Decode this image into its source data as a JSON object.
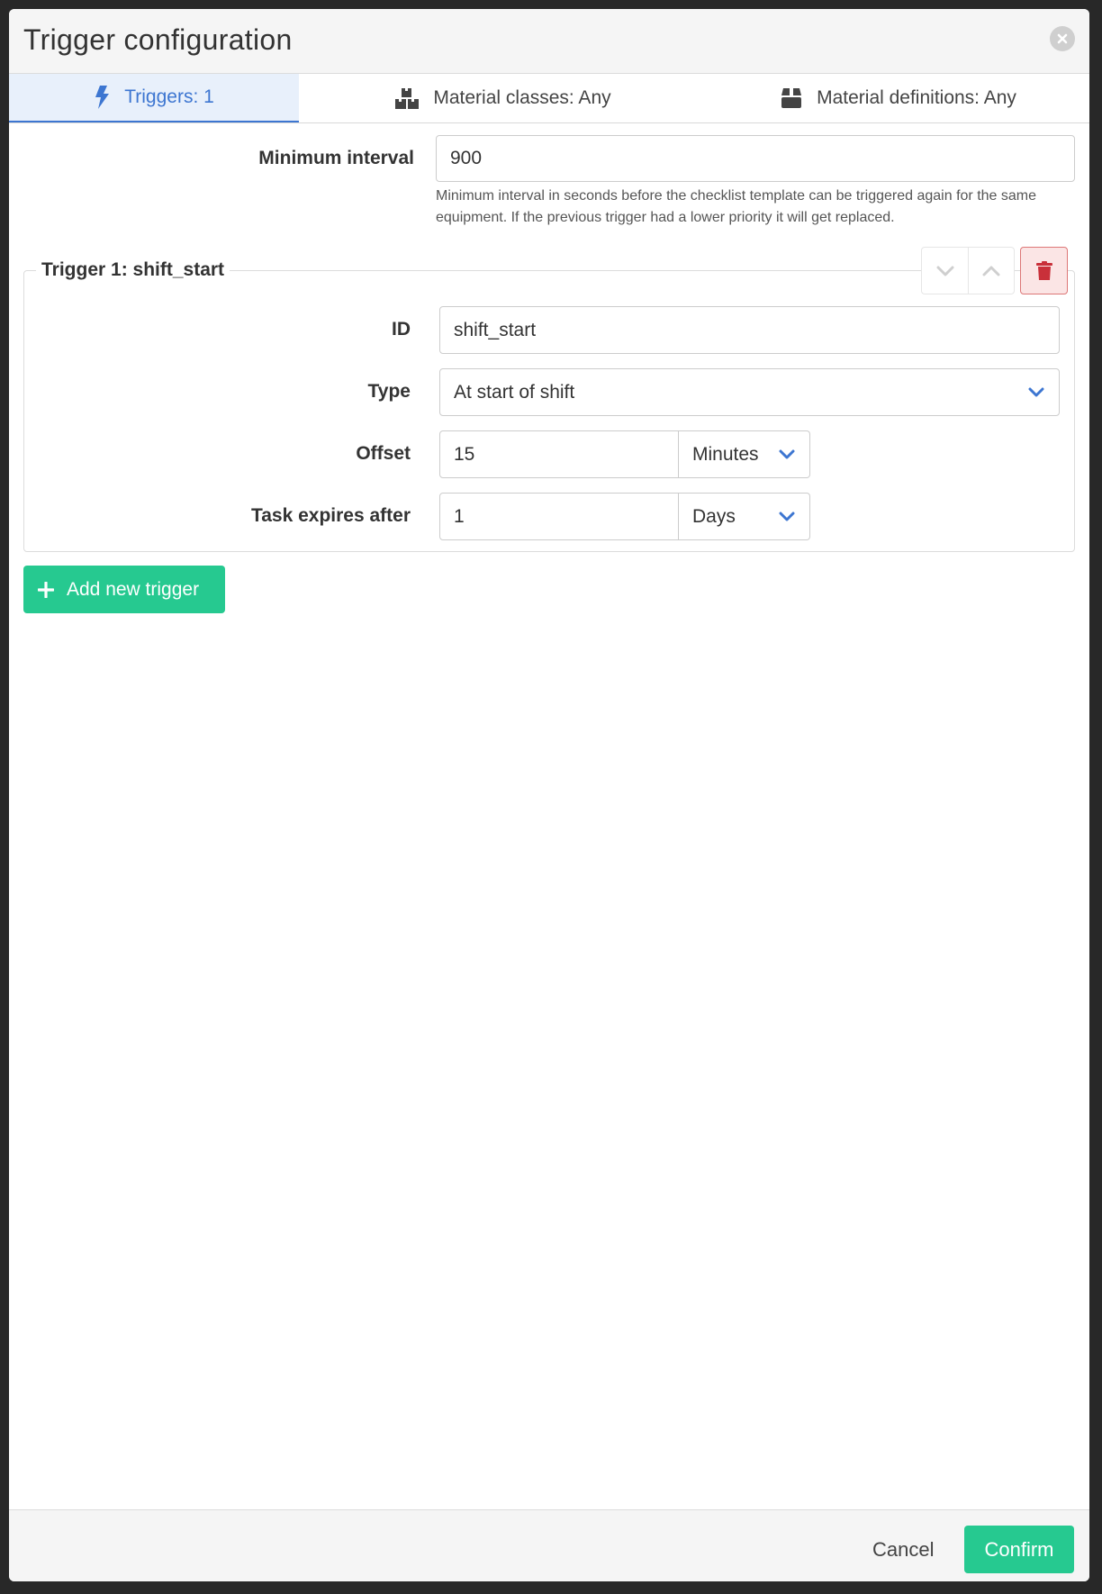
{
  "modal": {
    "title": "Trigger configuration"
  },
  "tabs": [
    {
      "label": "Triggers: 1",
      "icon": "bolt-icon",
      "active": true
    },
    {
      "label": "Material classes: Any",
      "icon": "boxes-icon",
      "active": false
    },
    {
      "label": "Material definitions: Any",
      "icon": "box-icon",
      "active": false
    }
  ],
  "minimum_interval": {
    "label": "Minimum interval",
    "value": "900",
    "help": "Minimum interval in seconds before the checklist template can be triggered again for the same equipment. If the previous trigger had a lower priority it will get replaced."
  },
  "trigger": {
    "legend": "Trigger 1: shift_start",
    "id_label": "ID",
    "id_value": "shift_start",
    "type_label": "Type",
    "type_value": "At start of shift",
    "offset_label": "Offset",
    "offset_value": "15",
    "offset_unit": "Minutes",
    "expires_label": "Task expires after",
    "expires_value": "1",
    "expires_unit": "Days"
  },
  "add_trigger_label": "Add new trigger",
  "footer": {
    "cancel_label": "Cancel",
    "confirm_label": "Confirm"
  },
  "colors": {
    "accent": "#3d76d1",
    "success": "#26c990",
    "danger": "#c9303a"
  }
}
